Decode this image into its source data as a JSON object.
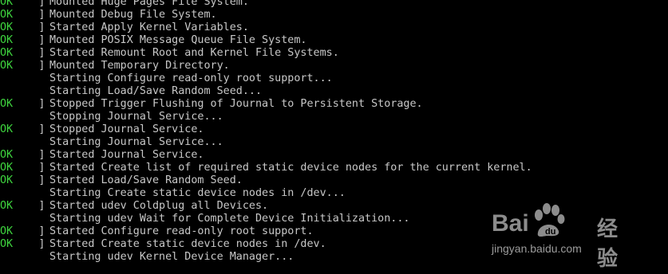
{
  "console": {
    "ok_label": "OK",
    "bracket": "]",
    "lines": [
      {
        "status": "OK",
        "message": "Mounted Huge Pages File System."
      },
      {
        "status": "OK",
        "message": "Mounted Debug File System."
      },
      {
        "status": "OK",
        "message": "Started Apply Kernel Variables."
      },
      {
        "status": "OK",
        "message": "Mounted POSIX Message Queue File System."
      },
      {
        "status": "OK",
        "message": "Started Remount Root and Kernel File Systems."
      },
      {
        "status": "OK",
        "message": "Mounted Temporary Directory."
      },
      {
        "status": "",
        "message": "Starting Configure read-only root support..."
      },
      {
        "status": "",
        "message": "Starting Load/Save Random Seed..."
      },
      {
        "status": "OK",
        "message": "Stopped Trigger Flushing of Journal to Persistent Storage."
      },
      {
        "status": "",
        "message": "Stopping Journal Service..."
      },
      {
        "status": "OK",
        "message": "Stopped Journal Service."
      },
      {
        "status": "",
        "message": "Starting Journal Service..."
      },
      {
        "status": "OK",
        "message": "Started Journal Service."
      },
      {
        "status": "OK",
        "message": "Started Create list of required static device nodes for the current kernel."
      },
      {
        "status": "OK",
        "message": "Started Load/Save Random Seed."
      },
      {
        "status": "",
        "message": "Starting Create static device nodes in /dev..."
      },
      {
        "status": "OK",
        "message": "Started udev Coldplug all Devices."
      },
      {
        "status": "",
        "message": "Starting udev Wait for Complete Device Initialization..."
      },
      {
        "status": "OK",
        "message": "Started Configure read-only root support."
      },
      {
        "status": "OK",
        "message": "Started Create static device nodes in /dev."
      },
      {
        "status": "",
        "message": "Starting udev Kernel Device Manager..."
      }
    ]
  },
  "watermark": {
    "brand_left": "Bai",
    "brand_right": "du",
    "brand_cn": "经验",
    "url": "jingyan.baidu.com"
  },
  "colors": {
    "ok": "#3ed43e",
    "text": "#c8c8c8",
    "background": "#000000"
  }
}
